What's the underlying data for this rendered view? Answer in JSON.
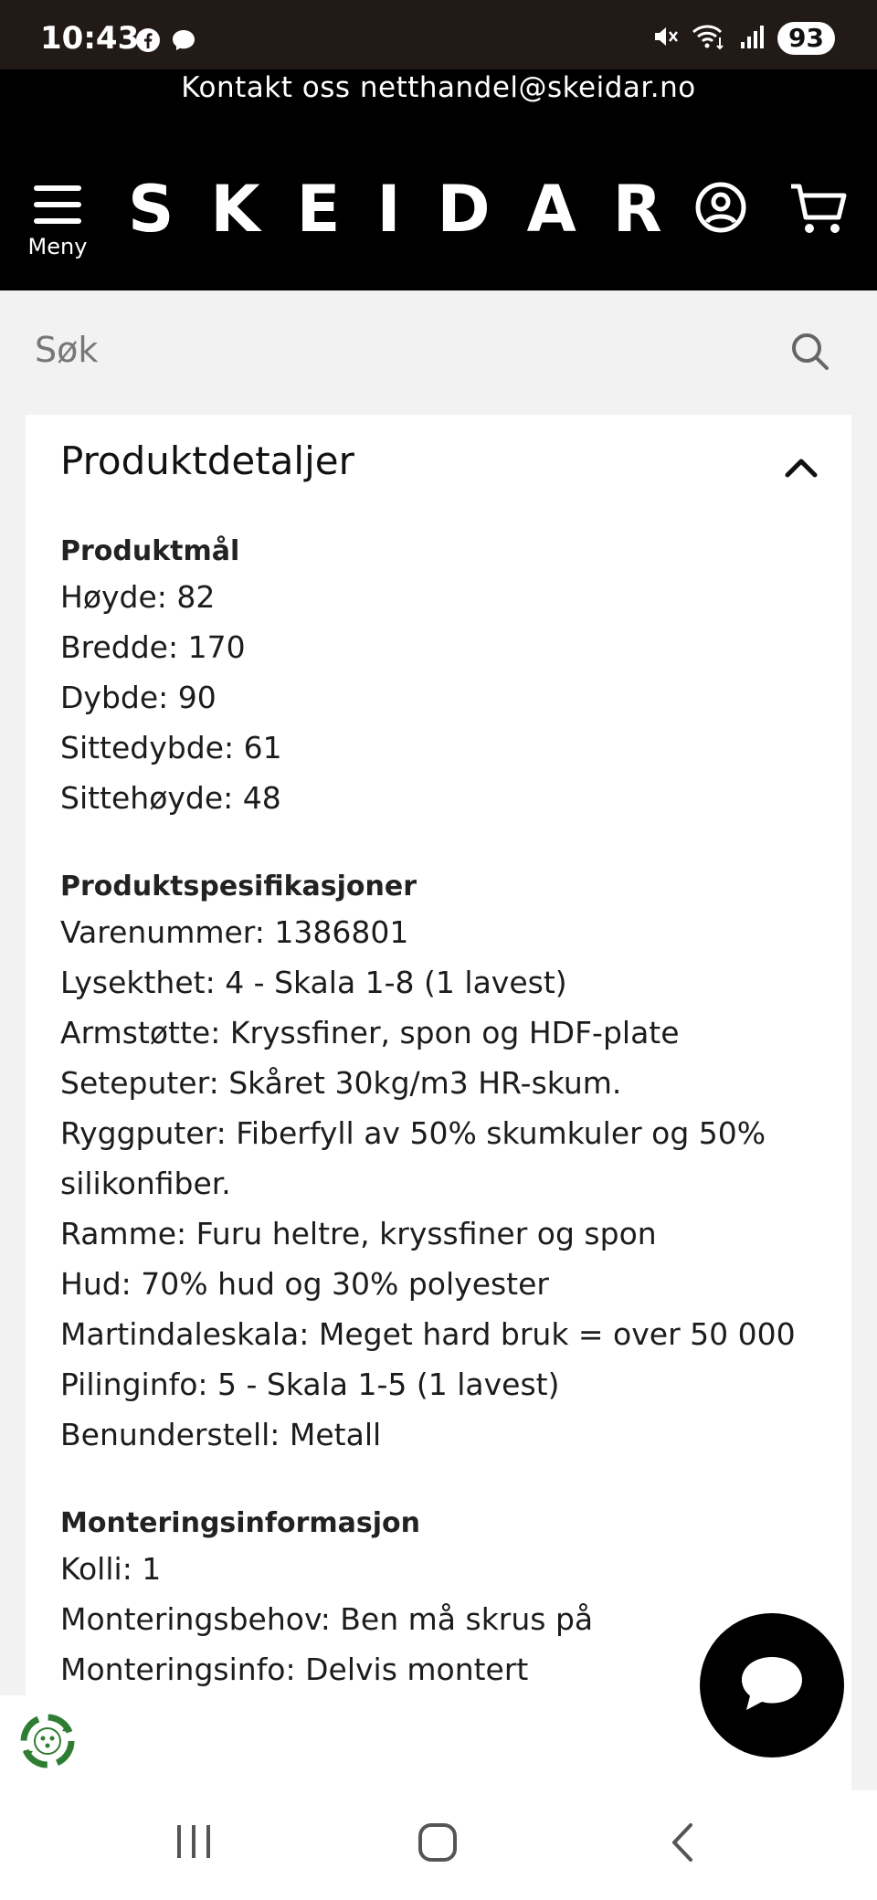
{
  "status_bar": {
    "time": "10:43",
    "app_icons": [
      "facebook-icon",
      "messenger-icon"
    ],
    "system_icons": [
      "mute-icon",
      "wifi-icon",
      "signal-icon"
    ],
    "battery": "93"
  },
  "header": {
    "contact_text": "Kontakt oss netthandel@skeidar.no",
    "menu_label": "Meny",
    "logo_text": "SKEIDAR",
    "icons": [
      "menu-icon",
      "account-icon",
      "cart-icon"
    ]
  },
  "search": {
    "placeholder": "Søk",
    "icon": "search-icon"
  },
  "product_details": {
    "title": "Produktdetaljer",
    "toggle_icon": "chevron-up-icon",
    "sections": [
      {
        "heading": "Produktmål",
        "lines": [
          "Høyde: 82",
          "Bredde: 170",
          "Dybde: 90",
          "Sittedybde: 61",
          "Sittehøyde: 48"
        ]
      },
      {
        "heading": "Produktspesifikasjoner",
        "lines": [
          "Varenummer: 1386801",
          "Lysekthet: 4 - Skala 1-8 (1 lavest)",
          "Armstøtte: Kryssfiner, spon og HDF-plate",
          "Seteputer: Skåret 30kg/m3 HR-skum.",
          "Ryggputer: Fiberfyll av 50% skumkuler og 50% silikonfiber.",
          "Ramme: Furu heltre, kryssfiner og spon",
          "Hud: 70% hud og 30% polyester",
          "Martindaleskala: Meget hard bruk = over 50 000",
          "Pilinginfo: 5 - Skala 1-5 (1 lavest)",
          "Benunderstell: Metall"
        ]
      },
      {
        "heading": "Monteringsinformasjon",
        "lines": [
          "Kolli: 1",
          "Monteringsbehov: Ben må skrus på",
          "Monteringsinfo: Delvis montert"
        ]
      }
    ]
  },
  "floating": {
    "chat_icon": "chat-bubble-icon",
    "eco_icon": "eco-recycle-icon"
  },
  "nav_bar": {
    "icons": [
      "recent-apps-icon",
      "home-icon",
      "back-icon"
    ]
  },
  "colors": {
    "header_bg": "#000000",
    "status_bg": "#211a17",
    "page_bg": "#f2f2f2",
    "card_bg": "#ffffff",
    "eco_green": "#2e7d32"
  }
}
